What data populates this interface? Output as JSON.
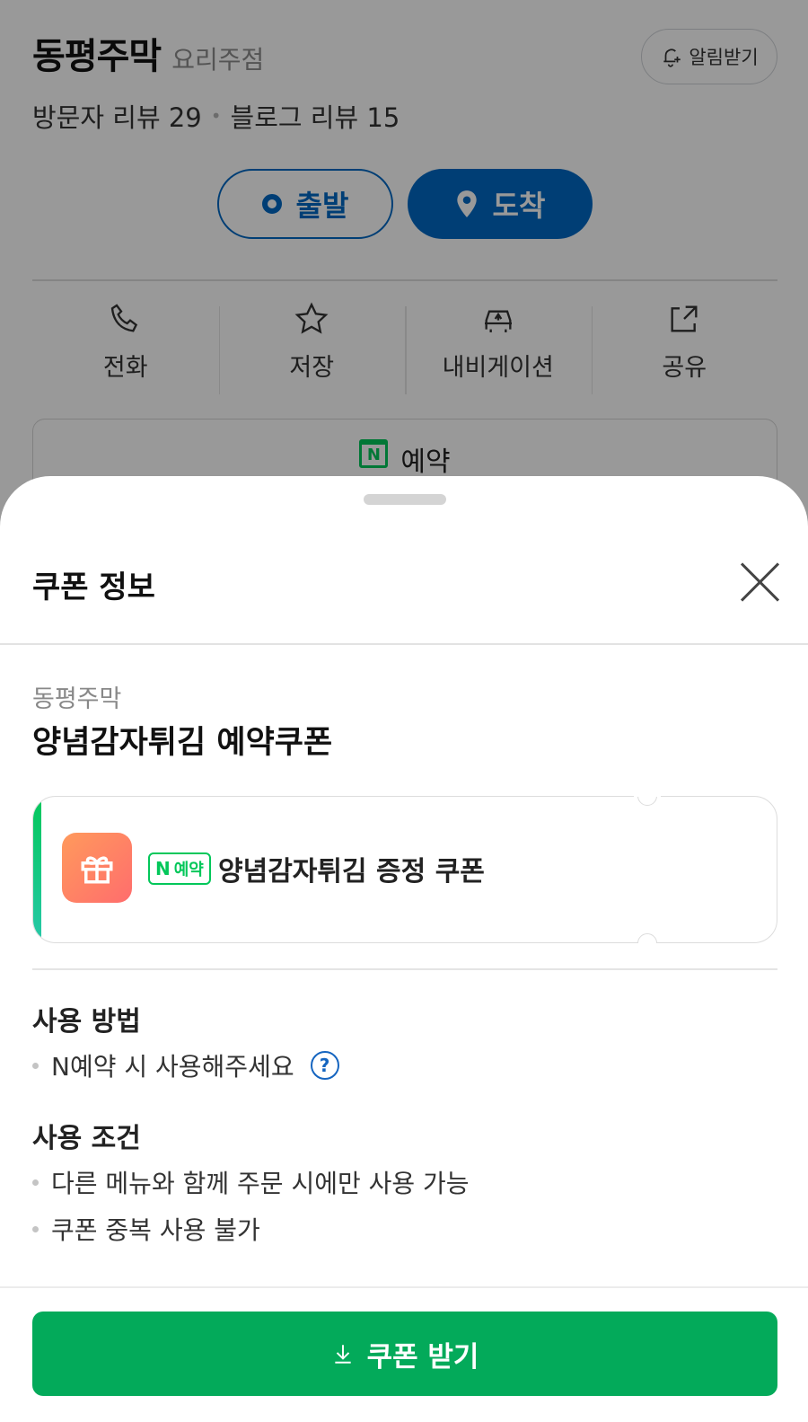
{
  "place": {
    "name": "동평주막",
    "category": "요리주점",
    "alarm_label": "알림받기",
    "visitor_reviews": "방문자 리뷰 29",
    "blog_reviews": "블로그 리뷰 15",
    "start_label": "출발",
    "end_label": "도착",
    "actions": [
      {
        "label": "전화",
        "icon": "phone-icon"
      },
      {
        "label": "저장",
        "icon": "star-icon"
      },
      {
        "label": "내비게이션",
        "icon": "car-navigation-icon"
      },
      {
        "label": "공유",
        "icon": "share-icon"
      }
    ],
    "reserve_label": "예약"
  },
  "sheet": {
    "title": "쿠폰 정보",
    "shop_name": "동평주막",
    "coupon_title": "양념감자튀김 예약쿠폰",
    "coupon": {
      "badge_n": "N",
      "badge_text": "예약",
      "description": "양념감자튀김 증정 쿠폰"
    },
    "usage": {
      "title": "사용 방법",
      "items": [
        "N예약 시 사용해주세요"
      ],
      "help_icon": "?"
    },
    "conditions": {
      "title": "사용 조건",
      "items": [
        "다른 메뉴와 함께 주문 시에만 사용 가능",
        "쿠폰 중복 사용 불가"
      ]
    },
    "button_label": "쿠폰 받기"
  },
  "colors": {
    "naver_green": "#03c75a",
    "button_green": "#03aa5a",
    "route_blue": "#0068c3",
    "help_blue": "#1565c0"
  }
}
